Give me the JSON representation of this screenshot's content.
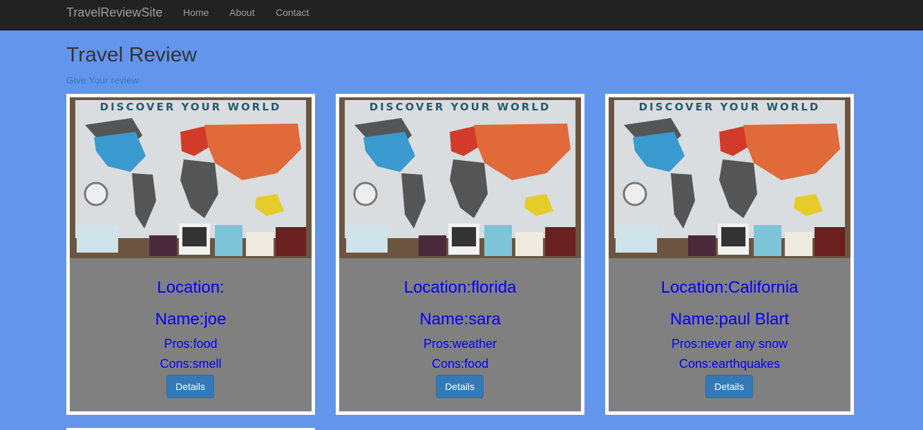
{
  "navbar": {
    "brand": "TravelReviewSite",
    "links": [
      "Home",
      "About",
      "Contact"
    ]
  },
  "header": {
    "title": "Travel Review",
    "subtitle": "Give Your review"
  },
  "image_text": "DISCOVER YOUR WORLD",
  "cards": [
    {
      "location": "Location:",
      "name": "Name:joe",
      "pros": "Pros:food",
      "cons": "Cons:smell",
      "button": "Details"
    },
    {
      "location": "Location:florida",
      "name": "Name:sara",
      "pros": "Pros:weather",
      "cons": "Cons:food",
      "button": "Details"
    },
    {
      "location": "Location:California",
      "name": "Name:paul Blart",
      "pros": "Pros:never any snow",
      "cons": "Cons:earthquakes",
      "button": "Details"
    }
  ],
  "colors": {
    "page_background": "#6495ed",
    "navbar": "#222222",
    "card_body": "#808080",
    "card_text": "#0000ff",
    "button": "#337ab7"
  }
}
